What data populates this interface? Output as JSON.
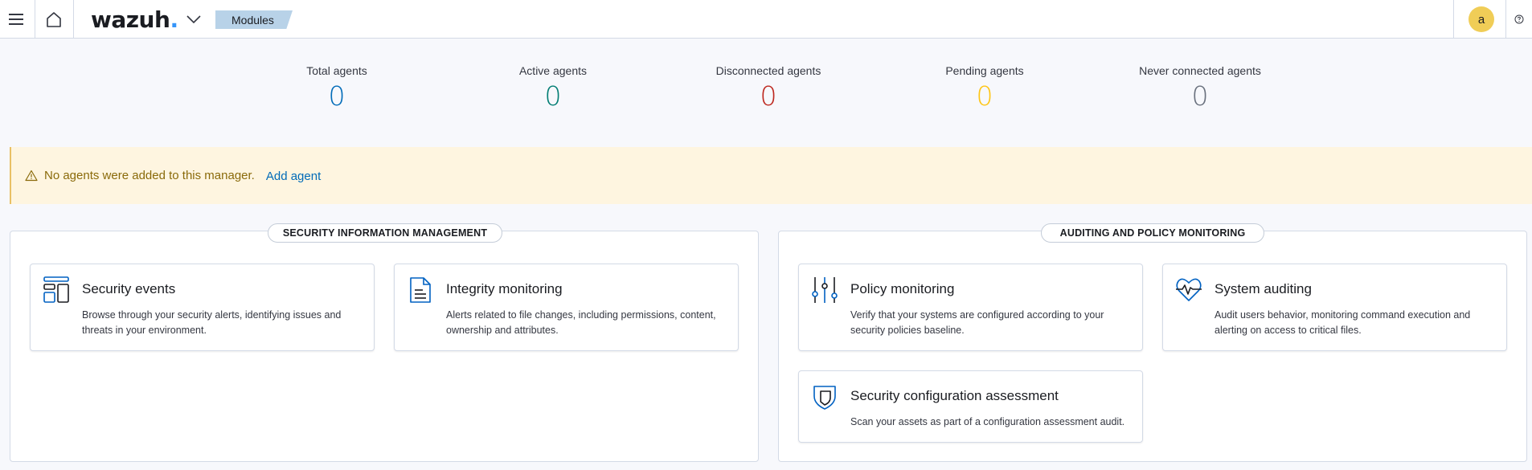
{
  "header": {
    "logo_text": "wazuh",
    "logo_dot": ".",
    "breadcrumb": "Modules",
    "avatar_initial": "a"
  },
  "stats": [
    {
      "label": "Total agents",
      "value": "0",
      "color": "#006bb8"
    },
    {
      "label": "Active agents",
      "value": "0",
      "color": "#017d73"
    },
    {
      "label": "Disconnected agents",
      "value": "0",
      "color": "#bd271e"
    },
    {
      "label": "Pending agents",
      "value": "0",
      "color": "#fec514"
    },
    {
      "label": "Never connected agents",
      "value": "0",
      "color": "#69707d"
    }
  ],
  "callout": {
    "message": "No agents were added to this manager.",
    "link": "Add agent"
  },
  "panels": {
    "sim": {
      "title": "SECURITY INFORMATION MANAGEMENT",
      "cards": [
        {
          "title": "Security events",
          "description": "Browse through your security alerts, identifying issues and threats in your environment.",
          "icon": "security-events-icon"
        },
        {
          "title": "Integrity monitoring",
          "description": "Alerts related to file changes, including permissions, content, ownership and attributes.",
          "icon": "document-icon"
        }
      ]
    },
    "apm": {
      "title": "AUDITING AND POLICY MONITORING",
      "cards": [
        {
          "title": "Policy monitoring",
          "description": "Verify that your systems are configured according to your security policies baseline.",
          "icon": "sliders-icon"
        },
        {
          "title": "System auditing",
          "description": "Audit users behavior, monitoring command execution and alerting on access to critical files.",
          "icon": "heart-pulse-icon"
        },
        {
          "title": "Security configuration assessment",
          "description": "Scan your assets as part of a configuration assessment audit.",
          "icon": "shield-icon"
        }
      ]
    }
  },
  "colors": {
    "accent": "#006bb8",
    "icon_blue": "#0061c2",
    "warning_bg": "#fef5e0"
  }
}
